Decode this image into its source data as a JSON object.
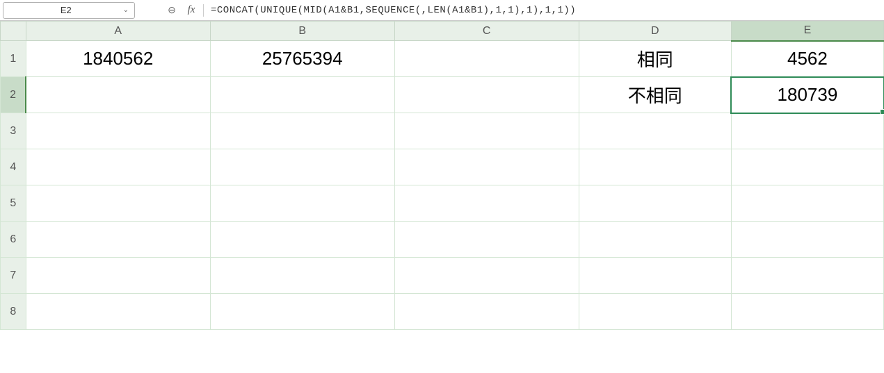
{
  "name_box": {
    "value": "E2"
  },
  "formula_bar": {
    "fx_label": "fx",
    "formula": "=CONCAT(UNIQUE(MID(A1&B1,SEQUENCE(,LEN(A1&B1),1,1),1),1,1))"
  },
  "columns": [
    "A",
    "B",
    "C",
    "D",
    "E"
  ],
  "row_headers": [
    "1",
    "2",
    "3",
    "4",
    "5",
    "6",
    "7",
    "8"
  ],
  "active_cell": "E2",
  "cells": {
    "A1": "1840562",
    "B1": "25765394",
    "D1": "相同",
    "E1": "4562",
    "D2": "不相同",
    "E2": "180739"
  },
  "icons": {
    "zoom_out": "⊖",
    "chevron_down": "⌄"
  }
}
